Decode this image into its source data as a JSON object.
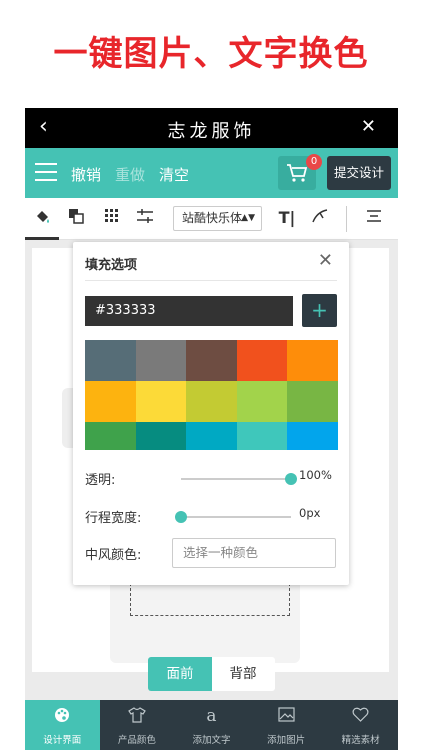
{
  "headline": "一键图片、文字换色",
  "titlebar": {
    "back_icon": "chevron-left-icon",
    "title": "志龙服饰",
    "close_icon": "close-icon"
  },
  "actionbar": {
    "undo": "撤销",
    "redo": "重做",
    "clear": "清空",
    "cart_count": "0",
    "submit": "提交设计"
  },
  "toolbar": {
    "font_name": "站酷快乐体",
    "text_tool_glyph": "T|"
  },
  "fill_panel": {
    "title": "填充选项",
    "color_value": "#333333",
    "add_label": "+",
    "swatches": [
      "#566d77",
      "#7a7a7a",
      "#6e4d42",
      "#f1511d",
      "#fe8d0a",
      "#fdb30f",
      "#fcda38",
      "#c3cb33",
      "#a2d34b",
      "#78b644",
      "#3fa24b",
      "#068c80",
      "#00a9c3",
      "#3fc7bb",
      "#02a5ec"
    ],
    "opacity_label": "透明:",
    "opacity_value": "100%",
    "opacity_fraction": 1.0,
    "stroke_label": "行程宽度:",
    "stroke_value": "0px",
    "stroke_fraction": 0.0,
    "wind_label": "中风颜色:",
    "wind_placeholder": "选择一种颜色"
  },
  "view_toggle": {
    "front": "面前",
    "back": "背部"
  },
  "bottom_nav": [
    {
      "icon": "palette-icon",
      "label": "设计界面",
      "active": true
    },
    {
      "icon": "tshirt-icon",
      "label": "产品颜色",
      "active": false
    },
    {
      "icon": "text-icon",
      "label": "添加文字",
      "active": false
    },
    {
      "icon": "image-icon",
      "label": "添加图片",
      "active": false
    },
    {
      "icon": "heart-icon",
      "label": "精选素材",
      "active": false
    }
  ],
  "colors": {
    "accent": "#45c2b4",
    "dark": "#2d3a42",
    "headline": "#e8262b"
  }
}
